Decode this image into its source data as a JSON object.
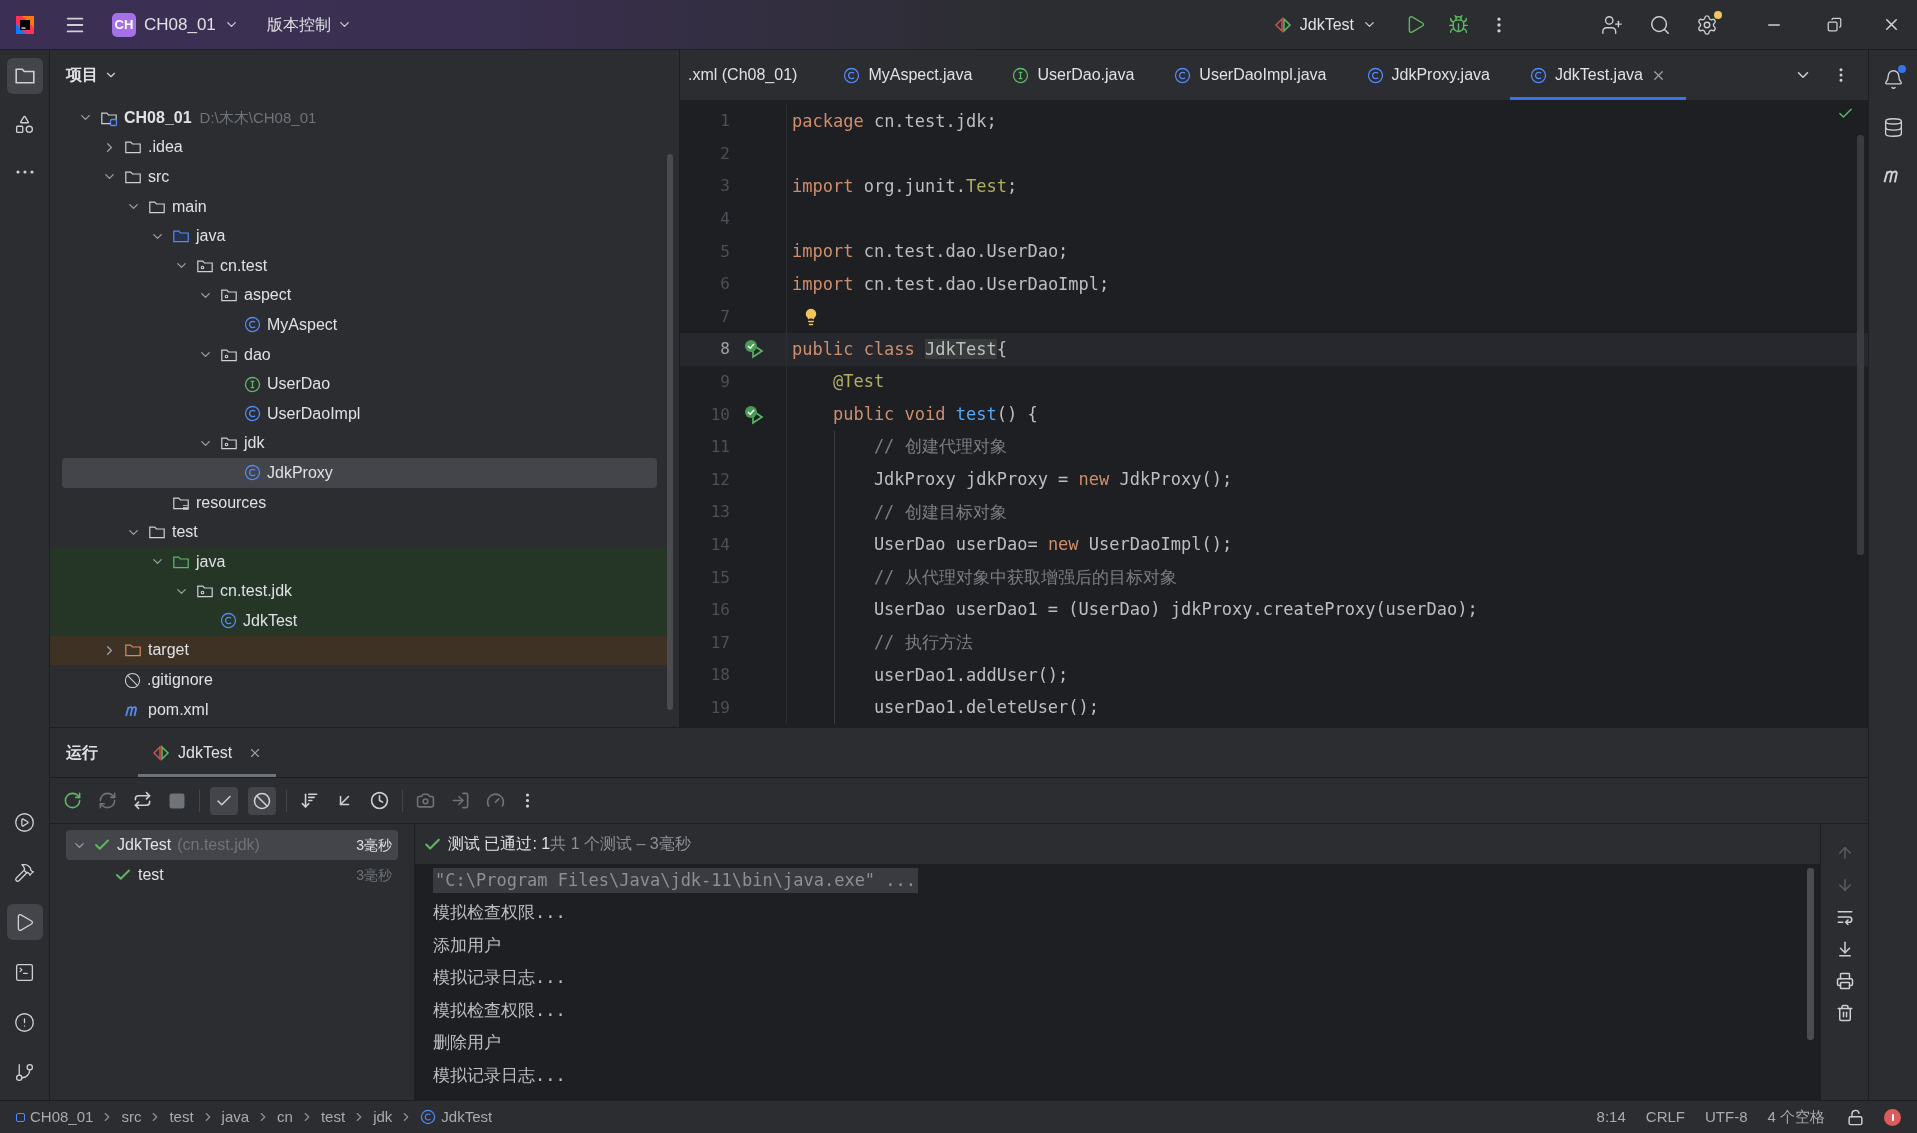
{
  "title_bar": {
    "project_badge": "CH",
    "project": "CH08_01",
    "vcs": "版本控制",
    "run_config": "JdkTest"
  },
  "left_toolbar": {
    "top": [
      {
        "kind": "project",
        "selected": true
      },
      {
        "kind": "structure",
        "selected": false
      },
      {
        "kind": "more",
        "selected": false
      }
    ],
    "bottom": [
      {
        "kind": "services",
        "selected": false
      },
      {
        "kind": "build",
        "selected": false
      },
      {
        "kind": "run",
        "selected": true
      },
      {
        "kind": "terminal",
        "selected": false
      },
      {
        "kind": "problems",
        "selected": false
      },
      {
        "kind": "git",
        "selected": false
      }
    ]
  },
  "right_toolbar": [
    {
      "kind": "notifications",
      "badge": true
    },
    {
      "kind": "database",
      "badge": false
    },
    {
      "kind": "maven",
      "badge": false
    }
  ],
  "project_panel": {
    "title": "项目",
    "tree": [
      {
        "kind": "project",
        "label": "CH08_01",
        "detail": "D:\\木木\\CH08_01",
        "expanded": true,
        "selected": false,
        "children": [
          {
            "kind": "folder",
            "label": ".idea",
            "expanded": false,
            "selected": false
          },
          {
            "kind": "folder",
            "label": "src",
            "expanded": true,
            "selected": false,
            "children": [
              {
                "kind": "folder",
                "label": "main",
                "expanded": true,
                "selected": false,
                "children": [
                  {
                    "kind": "source_root",
                    "label": "java",
                    "expanded": true,
                    "selected": false,
                    "children": [
                      {
                        "kind": "package",
                        "label": "cn.test",
                        "expanded": true,
                        "selected": false,
                        "children": [
                          {
                            "kind": "package",
                            "label": "aspect",
                            "expanded": true,
                            "selected": false,
                            "children": [
                              {
                                "kind": "class",
                                "label": "MyAspect",
                                "selected": false
                              }
                            ]
                          },
                          {
                            "kind": "package",
                            "label": "dao",
                            "expanded": true,
                            "selected": false,
                            "children": [
                              {
                                "kind": "interface",
                                "label": "UserDao",
                                "selected": false
                              },
                              {
                                "kind": "class",
                                "label": "UserDaoImpl",
                                "selected": false
                              }
                            ]
                          },
                          {
                            "kind": "package",
                            "label": "jdk",
                            "expanded": true,
                            "selected": false,
                            "children": [
                              {
                                "kind": "class",
                                "label": "JdkProxy",
                                "selected": true
                              }
                            ]
                          }
                        ]
                      }
                    ]
                  },
                  {
                    "kind": "resources",
                    "label": "resources",
                    "selected": false
                  }
                ]
              },
              {
                "kind": "folder",
                "label": "test",
                "expanded": true,
                "selected": false,
                "children": [
                  {
                    "kind": "test_root",
                    "label": "java",
                    "expanded": true,
                    "selected": false,
                    "children": [
                      {
                        "kind": "package",
                        "label": "cn.test.jdk",
                        "expanded": true,
                        "selected": false,
                        "children": [
                          {
                            "kind": "class",
                            "label": "JdkTest",
                            "selected": false
                          }
                        ]
                      }
                    ]
                  }
                ]
              }
            ]
          },
          {
            "kind": "excluded",
            "label": "target",
            "expanded": false,
            "selected": false
          },
          {
            "kind": "ignore",
            "label": ".gitignore",
            "selected": false
          },
          {
            "kind": "maven",
            "label": "pom.xml",
            "selected": false
          }
        ]
      }
    ]
  },
  "editor_tabs": [
    {
      "kind": "xml",
      "label": ".xml (Ch08_01)",
      "selected": false
    },
    {
      "kind": "class",
      "label": "MyAspect.java",
      "selected": false
    },
    {
      "kind": "interface",
      "label": "UserDao.java",
      "selected": false
    },
    {
      "kind": "class",
      "label": "UserDaoImpl.java",
      "selected": false
    },
    {
      "kind": "class",
      "label": "JdkProxy.java",
      "selected": false
    },
    {
      "kind": "class",
      "label": "JdkTest.java",
      "selected": true
    }
  ],
  "code_lines": [
    {
      "number": "1",
      "current": false,
      "tokens": [
        {
          "kind": "keyword",
          "text": "package"
        },
        {
          "kind": "plain",
          "text": " cn.test.jdk;"
        }
      ]
    },
    {
      "number": "2",
      "current": false
    },
    {
      "number": "3",
      "current": false,
      "tokens": [
        {
          "kind": "keyword",
          "text": "import"
        },
        {
          "kind": "plain",
          "text": " org.junit."
        },
        {
          "kind": "type",
          "text": "Test"
        },
        {
          "kind": "plain",
          "text": ";"
        }
      ]
    },
    {
      "number": "4",
      "current": false
    },
    {
      "number": "5",
      "current": false,
      "tokens": [
        {
          "kind": "keyword",
          "text": "import"
        },
        {
          "kind": "plain",
          "text": " cn.test.dao.UserDao;"
        }
      ]
    },
    {
      "number": "6",
      "current": false,
      "tokens": [
        {
          "kind": "keyword",
          "text": "import"
        },
        {
          "kind": "plain",
          "text": " cn.test.dao.UserDaoImpl;"
        }
      ]
    },
    {
      "number": "7",
      "current": false,
      "intention": true
    },
    {
      "number": "8",
      "current": true,
      "run_passed": true,
      "tokens": [
        {
          "kind": "keyword",
          "text": "public class "
        },
        {
          "kind": "usage",
          "text": "JdkTest"
        },
        {
          "kind": "plain",
          "text": "{"
        }
      ]
    },
    {
      "number": "9",
      "current": false,
      "tokens": [
        {
          "kind": "annotation",
          "text": "    @Test"
        }
      ]
    },
    {
      "number": "10",
      "current": false,
      "run_passed": true,
      "tokens": [
        {
          "kind": "keyword",
          "text": "    public void "
        },
        {
          "kind": "method",
          "text": "test"
        },
        {
          "kind": "plain",
          "text": "() {"
        }
      ]
    },
    {
      "number": "11",
      "current": false,
      "tokens": [
        {
          "kind": "comment",
          "text": "        // 创建代理对象"
        }
      ]
    },
    {
      "number": "12",
      "current": false,
      "tokens": [
        {
          "kind": "plain",
          "text": "        JdkProxy jdkProxy = "
        },
        {
          "kind": "keyword",
          "text": "new"
        },
        {
          "kind": "plain",
          "text": " JdkProxy();"
        }
      ]
    },
    {
      "number": "13",
      "current": false,
      "tokens": [
        {
          "kind": "comment",
          "text": "        // 创建目标对象"
        }
      ]
    },
    {
      "number": "14",
      "current": false,
      "tokens": [
        {
          "kind": "plain",
          "text": "        UserDao userDao= "
        },
        {
          "kind": "keyword",
          "text": "new"
        },
        {
          "kind": "plain",
          "text": " UserDaoImpl();"
        }
      ]
    },
    {
      "number": "15",
      "current": false,
      "tokens": [
        {
          "kind": "comment",
          "text": "        // 从代理对象中获取增强后的目标对象"
        }
      ]
    },
    {
      "number": "16",
      "current": false,
      "tokens": [
        {
          "kind": "plain",
          "text": "        UserDao userDao1 = (UserDao) jdkProxy.createProxy(userDao);"
        }
      ]
    },
    {
      "number": "17",
      "current": false,
      "tokens": [
        {
          "kind": "comment",
          "text": "        // 执行方法"
        }
      ]
    },
    {
      "number": "18",
      "current": false,
      "tokens": [
        {
          "kind": "plain",
          "text": "        userDao1.addUser();"
        }
      ]
    },
    {
      "number": "19",
      "current": false,
      "tokens": [
        {
          "kind": "plain",
          "text": "        userDao1.deleteUser();"
        }
      ]
    }
  ],
  "run_panel": {
    "title": "运行",
    "tab": {
      "label": "JdkTest",
      "selected": true
    },
    "toggles": [
      {
        "kind": "show_passed",
        "on": true
      },
      {
        "kind": "show_ignored",
        "on": true
      }
    ],
    "test_tree": [
      {
        "label": "JdkTest",
        "detail": "(cn.test.jdk)",
        "time": "3毫秒",
        "passed": true,
        "selected": true,
        "expanded": true,
        "children": [
          {
            "label": "test",
            "time": "3毫秒",
            "passed": true,
            "selected": false
          }
        ]
      }
    ],
    "summary": {
      "passed": true,
      "label": "测试 已通过: 1",
      "detail": "共 1 个测试 – 3毫秒"
    },
    "console": [
      {
        "kind": "command",
        "text": "\"C:\\Program Files\\Java\\jdk-11\\bin\\java.exe\" ..."
      },
      {
        "kind": "output",
        "text": "模拟检查权限..."
      },
      {
        "kind": "output",
        "text": "添加用户"
      },
      {
        "kind": "output",
        "text": "模拟记录日志..."
      },
      {
        "kind": "output",
        "text": "模拟检查权限..."
      },
      {
        "kind": "output",
        "text": "删除用户"
      },
      {
        "kind": "output",
        "text": "模拟记录日志..."
      }
    ]
  },
  "status_bar": {
    "breadcrumbs": [
      {
        "kind": "module",
        "label": "CH08_01"
      },
      {
        "kind": "folder",
        "label": "src"
      },
      {
        "kind": "folder",
        "label": "test"
      },
      {
        "kind": "folder",
        "label": "java"
      },
      {
        "kind": "folder",
        "label": "cn"
      },
      {
        "kind": "folder",
        "label": "test"
      },
      {
        "kind": "folder",
        "label": "jdk"
      },
      {
        "kind": "class",
        "label": "JdkTest"
      }
    ],
    "position": "8:14",
    "line_separator": "CRLF",
    "encoding": "UTF-8",
    "indent": "4 个空格",
    "errors": true
  }
}
